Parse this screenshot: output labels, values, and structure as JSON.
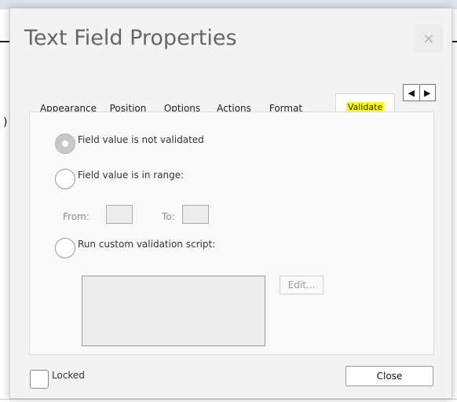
{
  "background": {
    "paren_text": ")"
  },
  "dialog": {
    "title": "Text Field Properties",
    "close_glyph": "×",
    "tabs": [
      {
        "label": "Appearance",
        "active": false
      },
      {
        "label": "Position",
        "active": false
      },
      {
        "label": "Options",
        "active": false
      },
      {
        "label": "Actions",
        "active": false
      },
      {
        "label": "Format",
        "active": false
      },
      {
        "label": "Validate",
        "active": true
      }
    ],
    "tab_scroll": {
      "left_glyph": "◀",
      "right_glyph": "▶"
    },
    "validate": {
      "options": [
        {
          "label": "Field value is not validated",
          "selected": true
        },
        {
          "label": "Field value is in range:",
          "selected": false
        },
        {
          "label": "Run custom validation script:",
          "selected": false
        }
      ],
      "range": {
        "from_label": "From:",
        "from_value": "",
        "to_label": "To:",
        "to_value": ""
      },
      "script_value": "",
      "edit_button": "Edit..."
    },
    "footer": {
      "locked_label": "Locked",
      "locked_checked": false,
      "close_button": "Close"
    }
  },
  "colors": {
    "highlight": "#ffff00",
    "dialog_bg": "#f3f3f3",
    "panel_bg": "#f9f9f9",
    "title_text": "#666666"
  },
  "icons": [
    "close-icon",
    "arrow-left-icon",
    "arrow-right-icon"
  ]
}
